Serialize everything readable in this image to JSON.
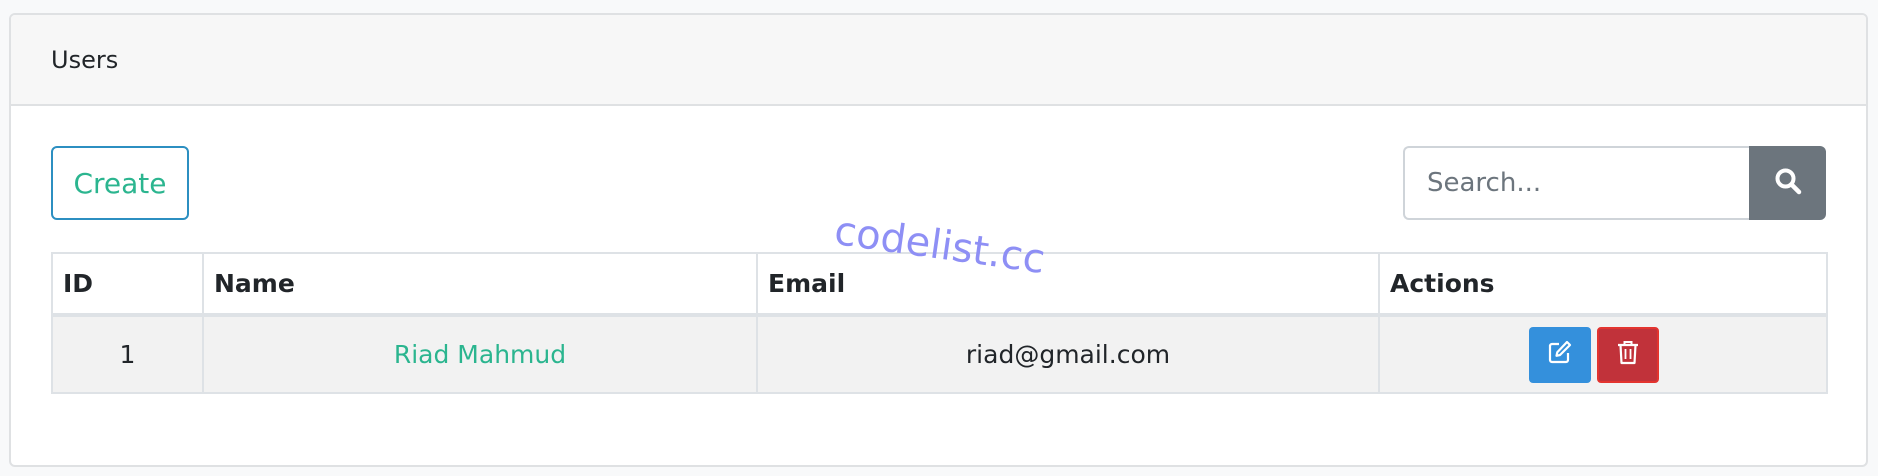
{
  "card": {
    "title": "Users"
  },
  "toolbar": {
    "create_label": "Create",
    "search_placeholder": "Search...",
    "search_value": ""
  },
  "table": {
    "columns": [
      "ID",
      "Name",
      "Email",
      "Actions"
    ],
    "rows": [
      {
        "id": "1",
        "name": "Riad Mahmud",
        "email": "riad@gmail.com"
      }
    ]
  },
  "icons": {
    "search": "search-icon",
    "edit": "edit-icon",
    "delete": "trash-icon"
  },
  "colors": {
    "accent_green": "#2bb58f",
    "primary_blue": "#3490dc",
    "danger_red": "#c1323a",
    "secondary_gray": "#6c757d"
  },
  "watermark": "codelist.cc"
}
